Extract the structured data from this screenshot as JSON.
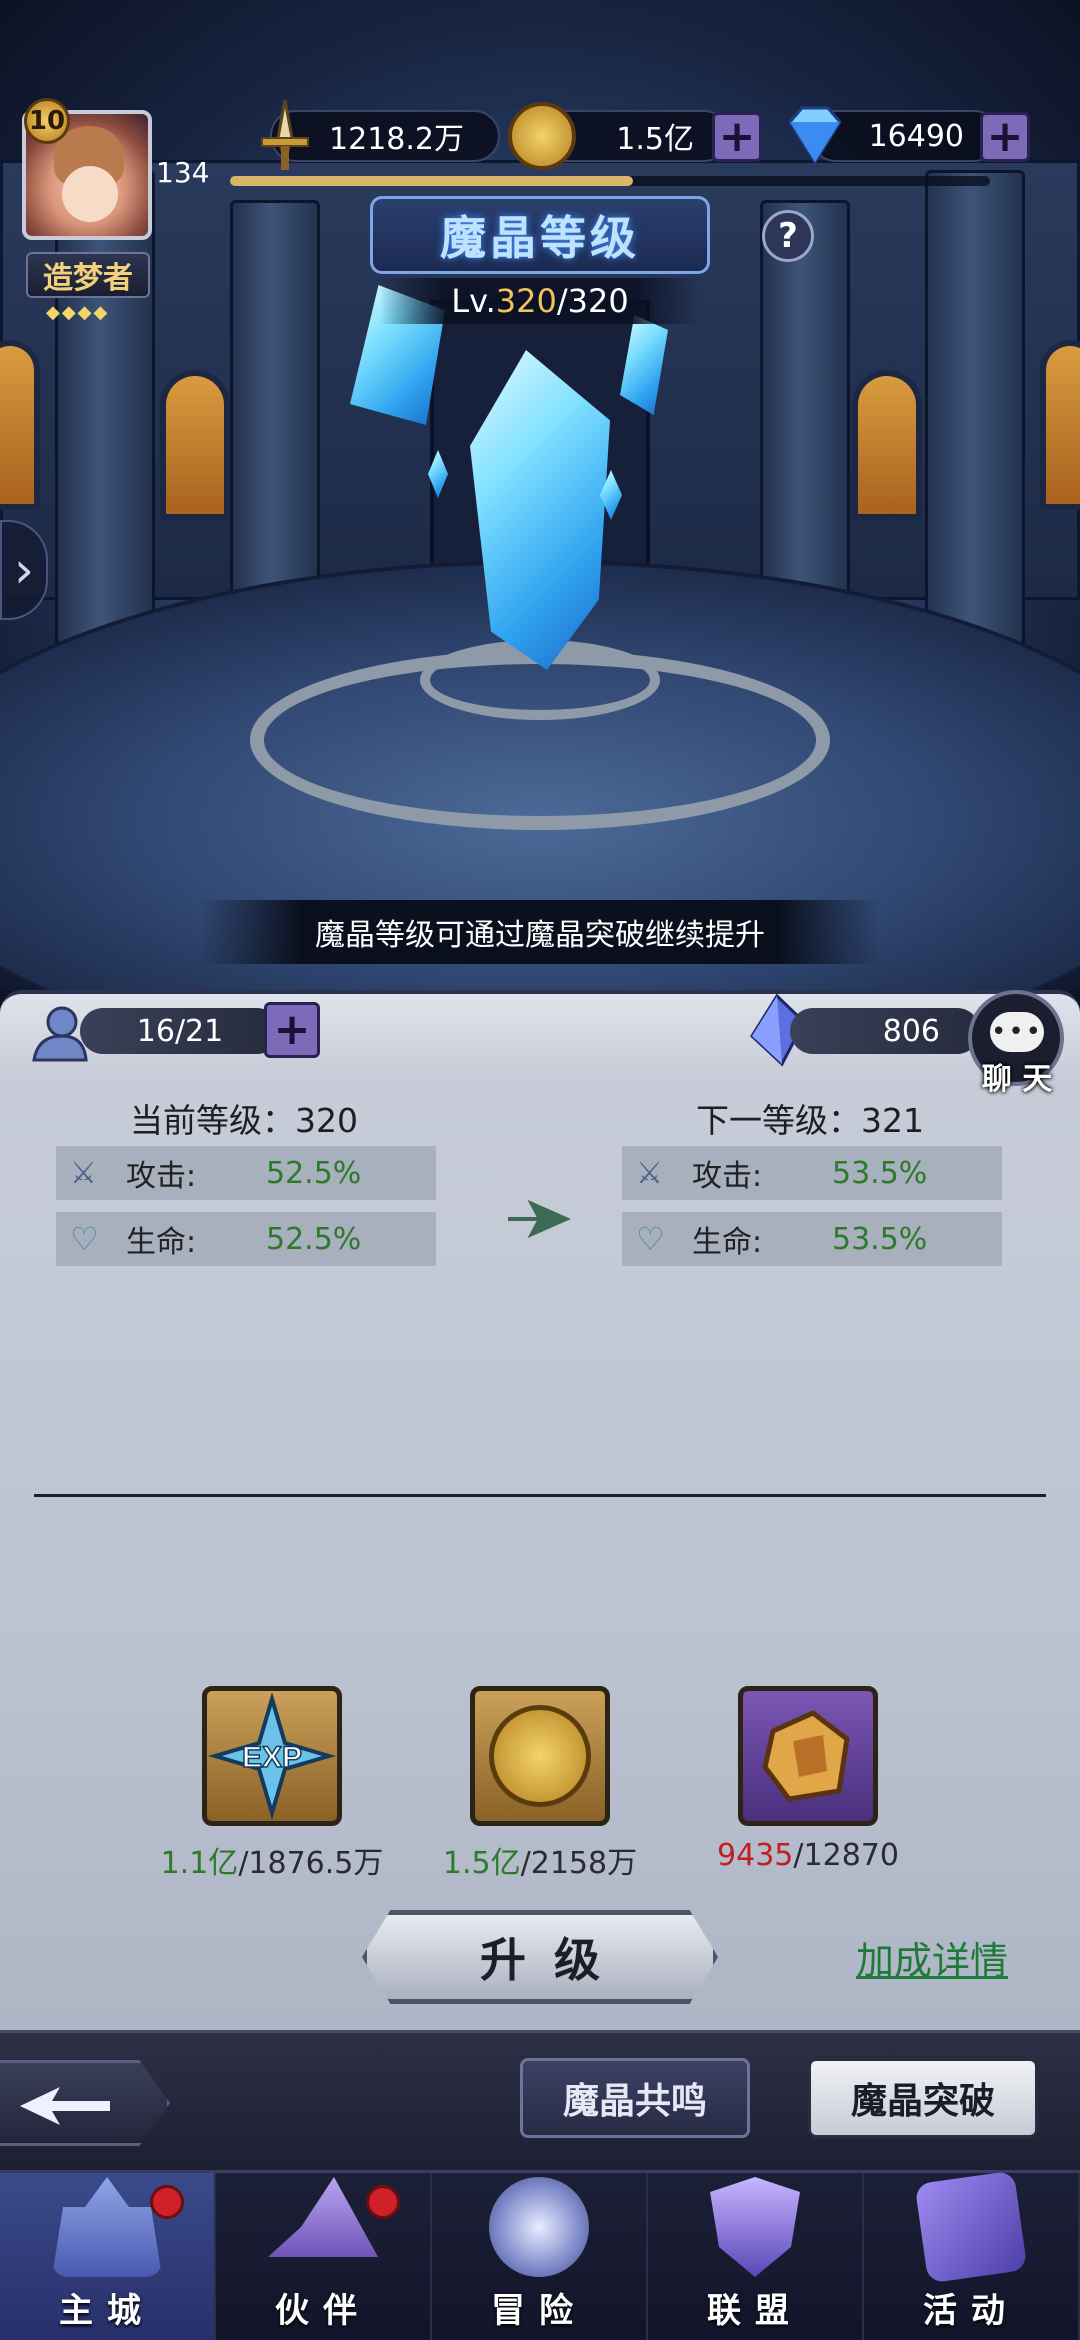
{
  "header": {
    "player": {
      "level": "10",
      "exp": "134",
      "title": "造梦者"
    },
    "resources": [
      {
        "name": "power",
        "icon": "sword-icon",
        "value": "1218.2万"
      },
      {
        "name": "gold",
        "icon": "gold-coin-icon",
        "value": "1.5亿"
      },
      {
        "name": "diamond",
        "icon": "diamond-icon",
        "value": "16490"
      }
    ],
    "exp_progress": 0.53
  },
  "scene": {
    "title": "魔晶等级",
    "level_prefix": "Lv.",
    "level_current": "320",
    "level_max": "/320",
    "caption": "魔晶等级可通过魔晶突破继续提升"
  },
  "panel": {
    "slots": "16/21",
    "crystal_count": "806",
    "chat_label": "聊 天",
    "current": {
      "heading": "当前等级：320",
      "stats": [
        {
          "label": "攻击:",
          "value": "52.5%"
        },
        {
          "label": "生命:",
          "value": "52.5%"
        }
      ]
    },
    "next": {
      "heading": "下一等级：321",
      "stats": [
        {
          "label": "攻击:",
          "value": "53.5%"
        },
        {
          "label": "生命:",
          "value": "53.5%"
        }
      ]
    },
    "costs": [
      {
        "icon": "exp-star-icon",
        "have": "1.1亿",
        "need": "/1876.5万",
        "have_color": "#2d7a2d"
      },
      {
        "icon": "gold-coin-icon",
        "have": "1.5亿",
        "need": "/2158万",
        "have_color": "#2d7a2d"
      },
      {
        "icon": "ore-icon",
        "have": "9435",
        "need": "/12870",
        "have_color": "#c02020"
      }
    ],
    "upgrade_label": "升级",
    "details_link": "加成详情"
  },
  "subbar": {
    "resonance": "魔晶共鸣",
    "breakthrough": "魔晶突破"
  },
  "nav": [
    {
      "label": "主城",
      "icon": "castle-icon",
      "active": true,
      "badge": true
    },
    {
      "label": "伙伴",
      "icon": "witch-hat-icon",
      "active": false,
      "badge": true
    },
    {
      "label": "冒险",
      "icon": "compass-icon",
      "active": false,
      "badge": false
    },
    {
      "label": "联盟",
      "icon": "shield-icon",
      "active": false,
      "badge": false
    },
    {
      "label": "活动",
      "icon": "cards-icon",
      "active": false,
      "badge": false
    }
  ],
  "colors": {
    "accent_green": "#2d7a2d",
    "warning_red": "#c02020",
    "crystal_blue": "#59c6ff"
  }
}
